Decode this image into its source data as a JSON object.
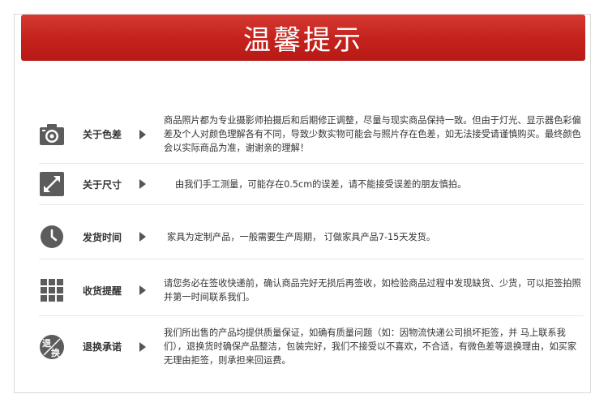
{
  "banner": {
    "title": "温馨提示"
  },
  "items": [
    {
      "label": "关于色差",
      "icon": "camera-icon",
      "text": "商品照片都为专业摄影师拍摄后和后期修正调整，尽量与现实商品保持一致。但由于灯光、显示器色彩偏差及个人对颜色理解各有不同，导致少数实物可能会与照片存在色差，如无法接受请谨慎购买。最终颜色会以实际商品为准，谢谢亲的理解！"
    },
    {
      "label": "关于尺寸",
      "icon": "resize-arrow-icon",
      "text": "由我们手工测量，可能存在0.5cm的误差，请不能接受误差的朋友慎拍。"
    },
    {
      "label": "发货时间",
      "icon": "clock-icon",
      "text": "家具为定制产品，一般需要生产周期， 订做家具产品7-15天发货。"
    },
    {
      "label": "收货提醒",
      "icon": "grid-icon",
      "text": "请您务必在签收快递前，确认商品完好无损后再签收，如检验商品过程中发现缺货、少货，可以拒签拍照并第一时间联系我们。"
    },
    {
      "label": "退换承诺",
      "icon": "return-exchange-icon",
      "icon_text": [
        "退",
        "换"
      ],
      "text": "我们所出售的产品均提供质量保证，如确有质量问题（如：因物流快递公司损坏拒签，并 马上联系我们），退换货时确保产品整洁，包装完好，我们不接受以不喜欢，不合适，有微色差等退换理由，如买家无理由拒签，则承担来回运费。"
    }
  ],
  "colors": {
    "banner": "#c4211c",
    "icon": "#5c5c5c",
    "text": "#333333"
  }
}
